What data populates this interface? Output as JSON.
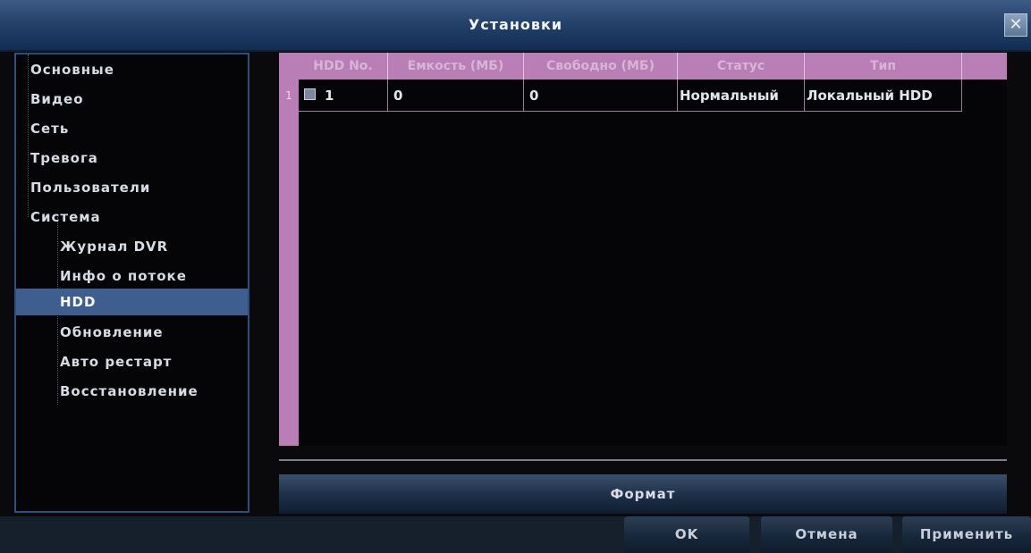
{
  "window": {
    "title": "Установки"
  },
  "sidebar": {
    "items": [
      {
        "label": "Основные",
        "level": 1,
        "selected": false
      },
      {
        "label": "Видео",
        "level": 1,
        "selected": false
      },
      {
        "label": "Сеть",
        "level": 1,
        "selected": false
      },
      {
        "label": "Тревога",
        "level": 1,
        "selected": false
      },
      {
        "label": "Пользователи",
        "level": 1,
        "selected": false
      },
      {
        "label": "Система",
        "level": 1,
        "selected": false
      },
      {
        "label": "Журнал DVR",
        "level": 2,
        "selected": false
      },
      {
        "label": "Инфо о потоке",
        "level": 2,
        "selected": false
      },
      {
        "label": "HDD",
        "level": 2,
        "selected": true
      },
      {
        "label": "Обновление",
        "level": 2,
        "selected": false
      },
      {
        "label": "Авто рестарт",
        "level": 2,
        "selected": false
      },
      {
        "label": "Восстановление",
        "level": 2,
        "selected": false
      }
    ]
  },
  "table": {
    "headers": [
      "HDD No.",
      "Емкость (МБ)",
      "Свободно (МБ)",
      "Статус",
      "Тип"
    ],
    "rows": [
      {
        "row_number": "1",
        "checked": false,
        "cells": [
          "1",
          "0",
          "0",
          "Нормальный",
          "Локальный HDD"
        ]
      }
    ]
  },
  "buttons": {
    "format": "Формат",
    "ok": "OK",
    "cancel": "Отмена",
    "apply": "Применить"
  },
  "colors": {
    "title_bar": "#23426b",
    "table_header": "#b97eb6",
    "sidebar_selected": "#3e5e8f",
    "button": "#1d2f47"
  }
}
